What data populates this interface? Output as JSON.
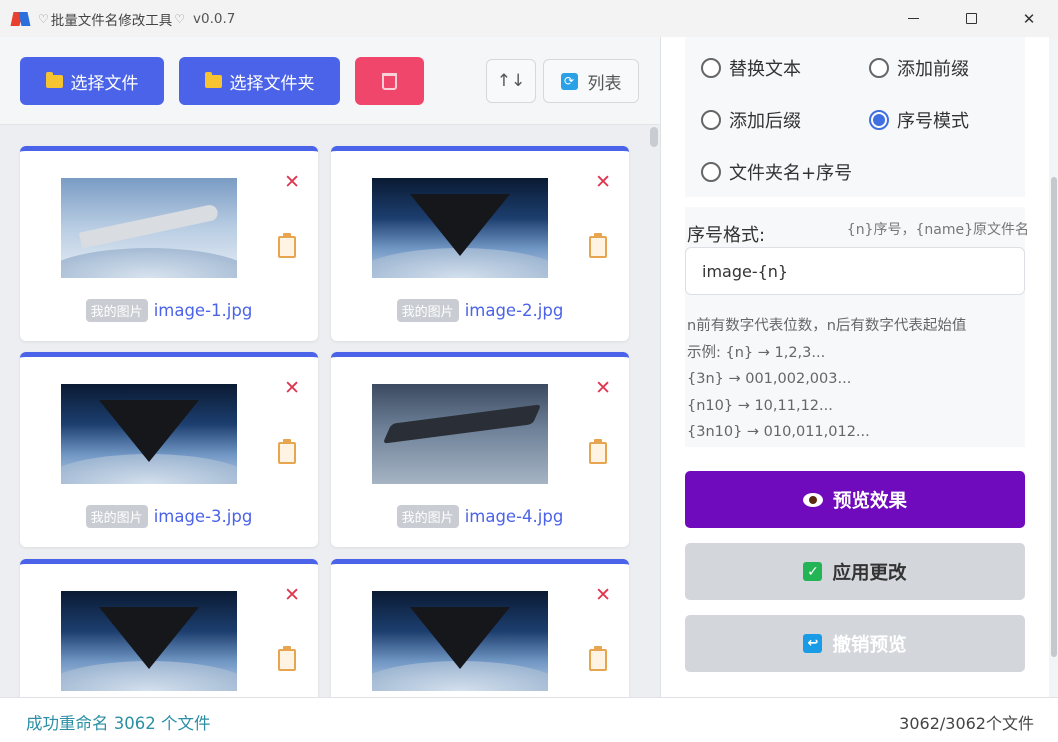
{
  "window": {
    "title": "批量文件名修改工具",
    "version": "v0.0.7",
    "controls": [
      "minimize",
      "maximize",
      "close"
    ]
  },
  "toolbar": {
    "select_files": "选择文件",
    "select_folder": "选择文件夹",
    "clear_icon": "trash-icon",
    "sort_icon": "sort-arrows-icon",
    "sort_glyph": "↑↓",
    "list_label": "列表"
  },
  "files": [
    {
      "tag": "我的图片",
      "name": "image-1.jpg",
      "thumb": "light"
    },
    {
      "tag": "我的图片",
      "name": "image-2.jpg",
      "thumb": "dark"
    },
    {
      "tag": "我的图片",
      "name": "image-3.jpg",
      "thumb": "dark"
    },
    {
      "tag": "我的图片",
      "name": "image-4.jpg",
      "thumb": "plain"
    },
    {
      "tag": "",
      "name": "",
      "thumb": "dark"
    },
    {
      "tag": "",
      "name": "",
      "thumb": "dark"
    }
  ],
  "modes": {
    "replace_text": "替换文本",
    "add_prefix": "添加前缀",
    "add_suffix": "添加后缀",
    "sequence_mode": "序号模式",
    "folder_sequence": "文件夹名+序号",
    "selected": "序号模式"
  },
  "format": {
    "label": "序号格式:",
    "hint": "{n}序号，{name}原文件名",
    "value": "image-{n}",
    "desc_line1": "n前有数字代表位数，n后有数字代表起始值",
    "desc_line2": "示例: {n} → 1,2,3...",
    "desc_line3": "{3n} → 001,002,003...",
    "desc_line4": "{n10} → 10,11,12...",
    "desc_line5": "{3n10} → 010,011,012..."
  },
  "actions": {
    "preview": "预览效果",
    "apply": "应用更改",
    "undo": "撤销预览"
  },
  "status": {
    "message": "成功重命名 3062 个文件",
    "progress": "3062/3062个文件"
  },
  "colors": {
    "accent": "#4b63e8",
    "danger": "#f0466b",
    "preview": "#6f0bbd",
    "status_text": "#2c8fa6"
  }
}
